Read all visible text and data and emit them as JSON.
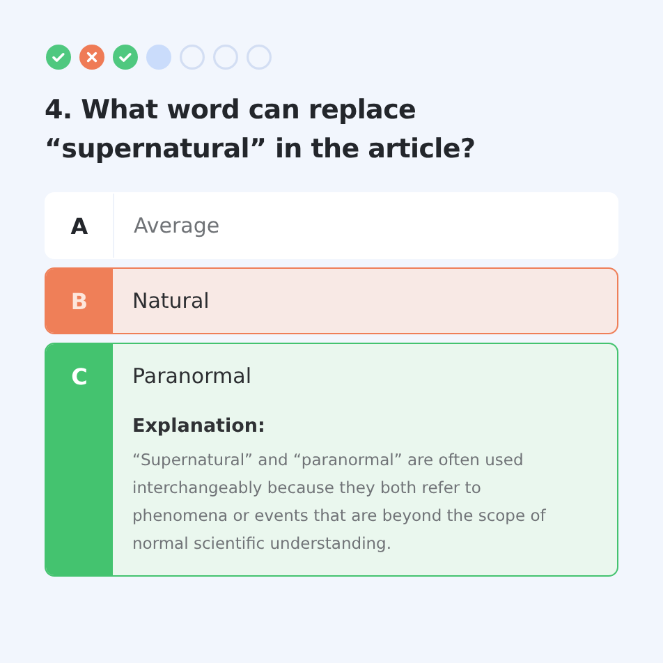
{
  "progress": [
    {
      "kind": "correct"
    },
    {
      "kind": "wrong"
    },
    {
      "kind": "correct"
    },
    {
      "kind": "current"
    },
    {
      "kind": "upcoming"
    },
    {
      "kind": "upcoming"
    },
    {
      "kind": "upcoming"
    }
  ],
  "question": "4. What word can replace “supernatural” in the article?",
  "options": [
    {
      "letter": "A",
      "text": "Average",
      "selected": false,
      "correct": false
    },
    {
      "letter": "B",
      "text": "Natural",
      "selected": true,
      "correct": false
    },
    {
      "letter": "C",
      "text": "Paranormal",
      "selected": false,
      "correct": true,
      "explanation_title": "Explanation:",
      "explanation": "“Supernatural” and “paranormal” are often used interchangeably because they both refer to phenomena or events that are beyond the scope of normal scientific understanding."
    }
  ]
}
